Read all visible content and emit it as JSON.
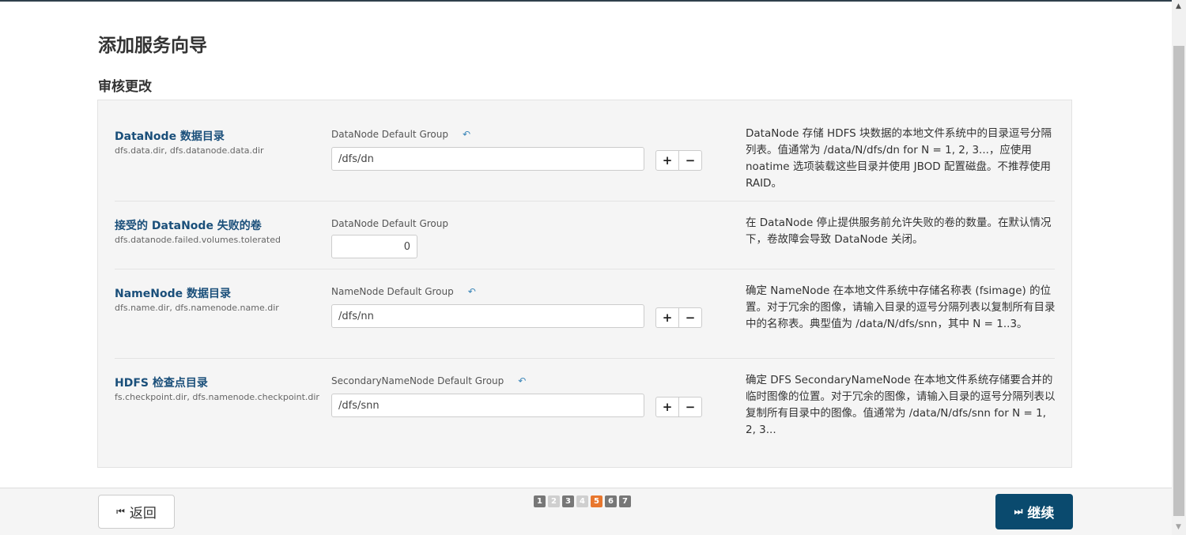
{
  "wizard": {
    "title": "添加服务向导",
    "subtitle": "审核更改"
  },
  "properties": [
    {
      "name": "DataNode 数据目录",
      "key": "dfs.data.dir, dfs.datanode.data.dir",
      "group": "DataNode Default Group",
      "value": "/dfs/dn",
      "description": "DataNode 存储 HDFS 块数据的本地文件系统中的目录逗号分隔列表。值通常为 /data/N/dfs/dn for N = 1, 2, 3...，应使用 noatime 选项装载这些目录并使用 JBOD 配置磁盘。不推荐使用 RAID。"
    },
    {
      "name": "接受的 DataNode 失败的卷",
      "key": "dfs.datanode.failed.volumes.tolerated",
      "group": "DataNode Default Group",
      "value": "0",
      "description": "在 DataNode 停止提供服务前允许失败的卷的数量。在默认情况下，卷故障会导致 DataNode 关闭。"
    },
    {
      "name": "NameNode 数据目录",
      "key": "dfs.name.dir, dfs.namenode.name.dir",
      "group": "NameNode Default Group",
      "value": "/dfs/nn",
      "description": "确定 NameNode 在本地文件系统中存储名称表 (fsimage) 的位置。对于冗余的图像，请输入目录的逗号分隔列表以复制所有目录中的名称表。典型值为 /data/N/dfs/snn，其中 N = 1..3。"
    },
    {
      "name": "HDFS 检查点目录",
      "key": "fs.checkpoint.dir, dfs.namenode.checkpoint.dir",
      "group": "SecondaryNameNode Default Group",
      "value": "/dfs/snn",
      "description": "确定 DFS SecondaryNameNode 在本地文件系统存储要合并的临时图像的位置。对于冗余的图像，请输入目录的逗号分隔列表以复制所有目录中的图像。值通常为 /data/N/dfs/snn for N = 1, 2, 3..."
    }
  ],
  "buttons": {
    "add": "+",
    "remove": "−",
    "undo_icon": "undo-arrow-icon",
    "back": "返回",
    "next": "继续"
  },
  "steps": {
    "labels": [
      "1",
      "2",
      "3",
      "4",
      "5",
      "6",
      "7"
    ],
    "current": "5",
    "colors": {
      "normal": "#777777",
      "current": "#e8772e",
      "disabled": "#cfcfcf"
    }
  }
}
